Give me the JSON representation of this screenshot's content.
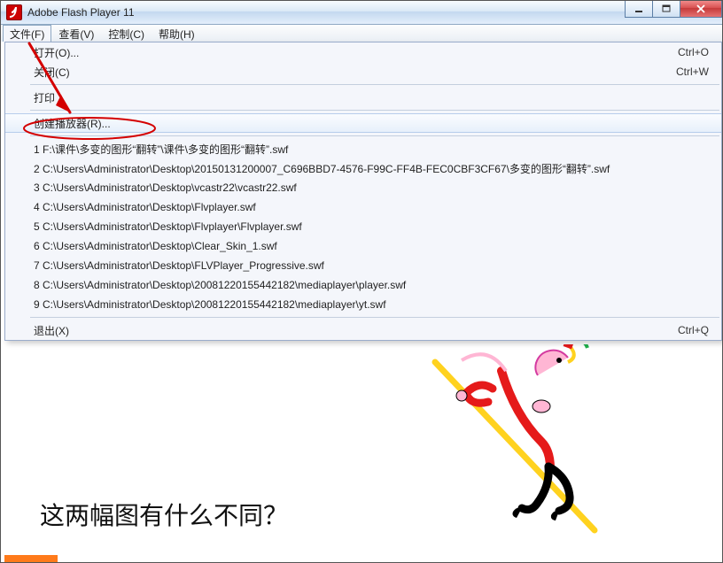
{
  "window": {
    "title": "Adobe Flash Player 11"
  },
  "menubar": {
    "file": "文件(F)",
    "view": "查看(V)",
    "control": "控制(C)",
    "help": "帮助(H)"
  },
  "file_menu": {
    "open": {
      "label": "打开(O)...",
      "accel": "Ctrl+O"
    },
    "close": {
      "label": "关闭(C)",
      "accel": "Ctrl+W"
    },
    "print": {
      "label": "打印"
    },
    "create": {
      "label": "创建播放器(R)..."
    },
    "recent": [
      "1 F:\\课件\\多变的图形“翻转”\\课件\\多变的图形“翻转”.swf",
      "2 C:\\Users\\Administrator\\Desktop\\20150131200007_C696BBD7-4576-F99C-FF4B-FEC0CBF3CF67\\多变的图形“翻转”.swf",
      "3 C:\\Users\\Administrator\\Desktop\\vcastr22\\vcastr22.swf",
      "4 C:\\Users\\Administrator\\Desktop\\Flvplayer.swf",
      "5 C:\\Users\\Administrator\\Desktop\\Flvplayer\\Flvplayer.swf",
      "6 C:\\Users\\Administrator\\Desktop\\Clear_Skin_1.swf",
      "7 C:\\Users\\Administrator\\Desktop\\FLVPlayer_Progressive.swf",
      "8 C:\\Users\\Administrator\\Desktop\\20081220155442182\\mediaplayer\\player.swf",
      "9 C:\\Users\\Administrator\\Desktop\\20081220155442182\\mediaplayer\\yt.swf"
    ],
    "exit": {
      "label": "退出(X)",
      "accel": "Ctrl+Q"
    }
  },
  "content": {
    "question": "这两幅图有什么不同？"
  }
}
